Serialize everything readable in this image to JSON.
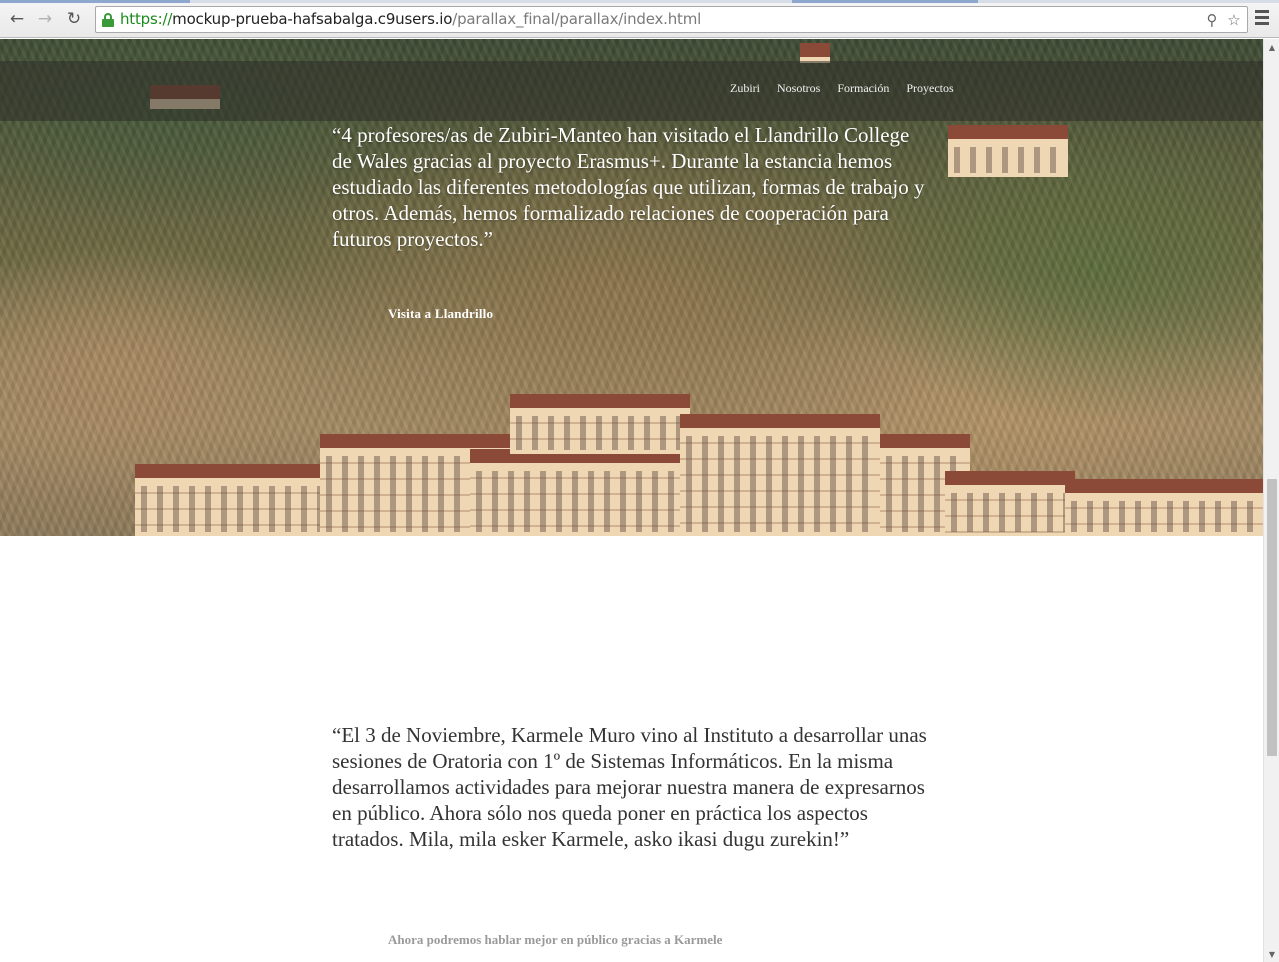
{
  "browser": {
    "url_scheme": "https://",
    "url_host": "mockup-prueba-hafsabalga.c9users.io",
    "url_path": "/parallax_final/parallax/index.html",
    "back_icon": "back-arrow-icon",
    "forward_icon": "forward-arrow-icon",
    "reload_icon": "reload-icon",
    "lock_icon": "lock-icon",
    "zoom_icon": "magnifier-icon",
    "bookmark_icon": "star-icon",
    "menu_icon": "hamburger-menu-icon",
    "secure_color": "#1e8a1e"
  },
  "nav": {
    "items": [
      {
        "label": "Zubiri"
      },
      {
        "label": "Nosotros"
      },
      {
        "label": "Formación"
      },
      {
        "label": "Proyectos"
      }
    ]
  },
  "hero": {
    "quote": "“4 profesores/as de Zubiri-Manteo han visitado el Llandrillo College de Wales gracias al proyecto Erasmus+. Durante la estancia hemos estudiado las diferentes metodologías que utilizan, formas de trabajo y otros. Además, hemos formalizado relaciones de cooperación para futuros proyectos.”",
    "caption": "Visita a Llandrillo"
  },
  "section2": {
    "quote": "“El 3 de Noviembre, Karmele Muro vino al Instituto a desarrollar unas sesiones de Oratoria con 1º de Sistemas Informáticos. En la misma desarrollamos actividades para mejorar nuestra manera de expresarnos en público. Ahora sólo nos queda poner en práctica los aspectos tratados. Mila, mila esker Karmele, asko ikasi dugu zurekin!”",
    "caption": "Ahora podremos hablar mejor en público gracias a Karmele"
  }
}
